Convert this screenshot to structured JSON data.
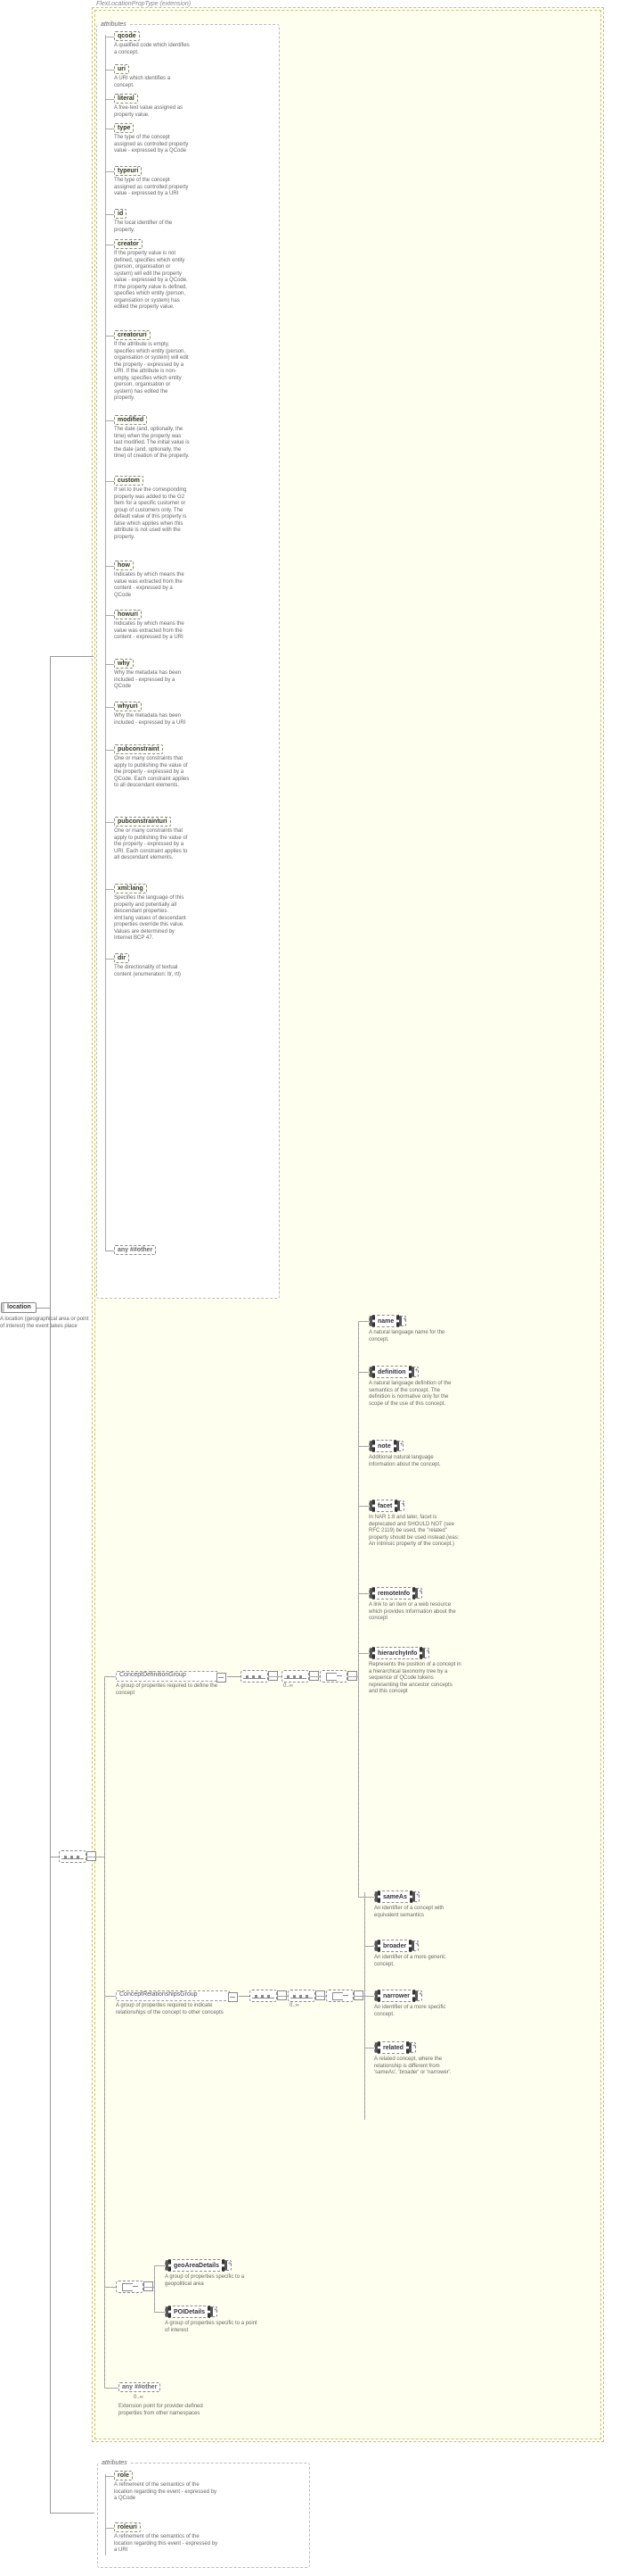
{
  "ext_title": "FlexLocationPropType (extension)",
  "root": {
    "label": "location",
    "desc": "A location (geographical area or point of interest) the event takes place"
  },
  "attr_panel_title": "attributes",
  "attrs": [
    {
      "name": "qcode",
      "desc": "A qualified code which identifies a concept."
    },
    {
      "name": "uri",
      "desc": "A URI which identifies a concept."
    },
    {
      "name": "literal",
      "desc": "A free-text value assigned as property value."
    },
    {
      "name": "type",
      "desc": "The type of the concept assigned as controlled property value - expressed by a QCode"
    },
    {
      "name": "typeuri",
      "desc": "The type of the concept assigned as controlled property value - expressed by a URI"
    },
    {
      "name": "id",
      "desc": "The local identifier of the property."
    },
    {
      "name": "creator",
      "desc": "If the property value is not defined, specifies which entity (person, organisation or system) will edit the property value - expressed by a QCode. If the property value is defined, specifies which entity (person, organisation or system) has edited the property value."
    },
    {
      "name": "creatoruri",
      "desc": "If the attribute is empty, specifies which entity (person, organisation or system) will edit the property - expressed by a URI. If the attribute is non-empty, specifies which entity (person, organisation or system) has edited the property."
    },
    {
      "name": "modified",
      "desc": "The date (and, optionally, the time) when the property was last modified. The initial value is the date (and, optionally, the time) of creation of the property."
    },
    {
      "name": "custom",
      "desc": "If set to true the corresponding property was added to the G2 Item for a specific customer or group of customers only. The default value of this property is false which applies when this attribute is not used with the property."
    },
    {
      "name": "how",
      "desc": "Indicates by which means the value was extracted from the content - expressed by a QCode"
    },
    {
      "name": "howuri",
      "desc": "Indicates by which means the value was extracted from the content - expressed by a URI"
    },
    {
      "name": "why",
      "desc": "Why the metadata has been included - expressed by a QCode"
    },
    {
      "name": "whyuri",
      "desc": "Why the metadata has been included - expressed by a URI"
    },
    {
      "name": "pubconstraint",
      "desc": "One or many constraints that apply to publishing the value of the property - expressed by a QCode. Each constraint applies to all descendant elements."
    },
    {
      "name": "pubconstrainturi",
      "desc": "One or many constraints that apply to publishing the value of the property - expressed by a URI. Each constraint applies to all descendant elements."
    },
    {
      "name": "xml:lang",
      "desc": "Specifies the language of this property and potentially all descendant properties. xml:lang values of descendant properties override this value. Values are determined by Internet BCP 47."
    },
    {
      "name": "dir",
      "desc": "The directionality of textual content (enumeration: ltr, rtl)"
    }
  ],
  "any_other": "any ##other",
  "groups": {
    "cdg": {
      "label": "ConceptDefinitionGroup",
      "desc": "A group of properites required to define the concept",
      "occ": "0..∞"
    },
    "crg": {
      "label": "ConceptRelationshipsGroup",
      "desc": "A group of properites required to indicate relationships of the concept to other concepts",
      "occ": "0..∞"
    }
  },
  "elems": {
    "name": {
      "label": "name",
      "desc": "A natural language name for the concept."
    },
    "definition": {
      "label": "definition",
      "desc": "A natural language definition of the semantics of the concept. The definition is normative only for the scope of the use of this concept."
    },
    "note": {
      "label": "note",
      "desc": "Additional natural language information about the concept."
    },
    "facet": {
      "label": "facet",
      "desc": "In NAR 1.8 and later, facet is deprecated and SHOULD NOT (see RFC 2119) be used, the \"related\" property should be used instead.(was: An intrinsic property of the concept.)"
    },
    "remoteInfo": {
      "label": "remoteInfo",
      "desc": "A link to an item or a web resource which provides information about the concept"
    },
    "hierarchyInfo": {
      "label": "hierarchyInfo",
      "desc": "Represents the position of a concept in a hierarchical taxonomy tree by a sequence of QCode tokens representing the ancestor concepts and this concept"
    },
    "sameAs": {
      "label": "sameAs",
      "desc": "An identifier of a concept with equivalent semantics"
    },
    "broader": {
      "label": "broader",
      "desc": "An identifier of a more generic concept."
    },
    "narrower": {
      "label": "narrower",
      "desc": "An identifier of a more specific concept."
    },
    "related": {
      "label": "related",
      "desc": "A related concept, where the relationship is different from 'sameAs', 'broader' or 'narrower'."
    },
    "geoAreaDetails": {
      "label": "geoAreaDetails",
      "desc": "A group of properties specific to a geopolitical area"
    },
    "POIDetails": {
      "label": "POIDetails",
      "desc": "A group of properties specific to a point of interest"
    }
  },
  "any2": {
    "label": "any ##other",
    "occ": "0..∞",
    "desc": "Extension point for provider-defined properties from other namespaces"
  },
  "attrs2": [
    {
      "name": "role",
      "desc": "A refinement of the semantics of the location regarding the event - expressed by a QCode"
    },
    {
      "name": "roleuri",
      "desc": "A refinement of the semantics of the location regarding this event - expressed by a URI"
    }
  ]
}
